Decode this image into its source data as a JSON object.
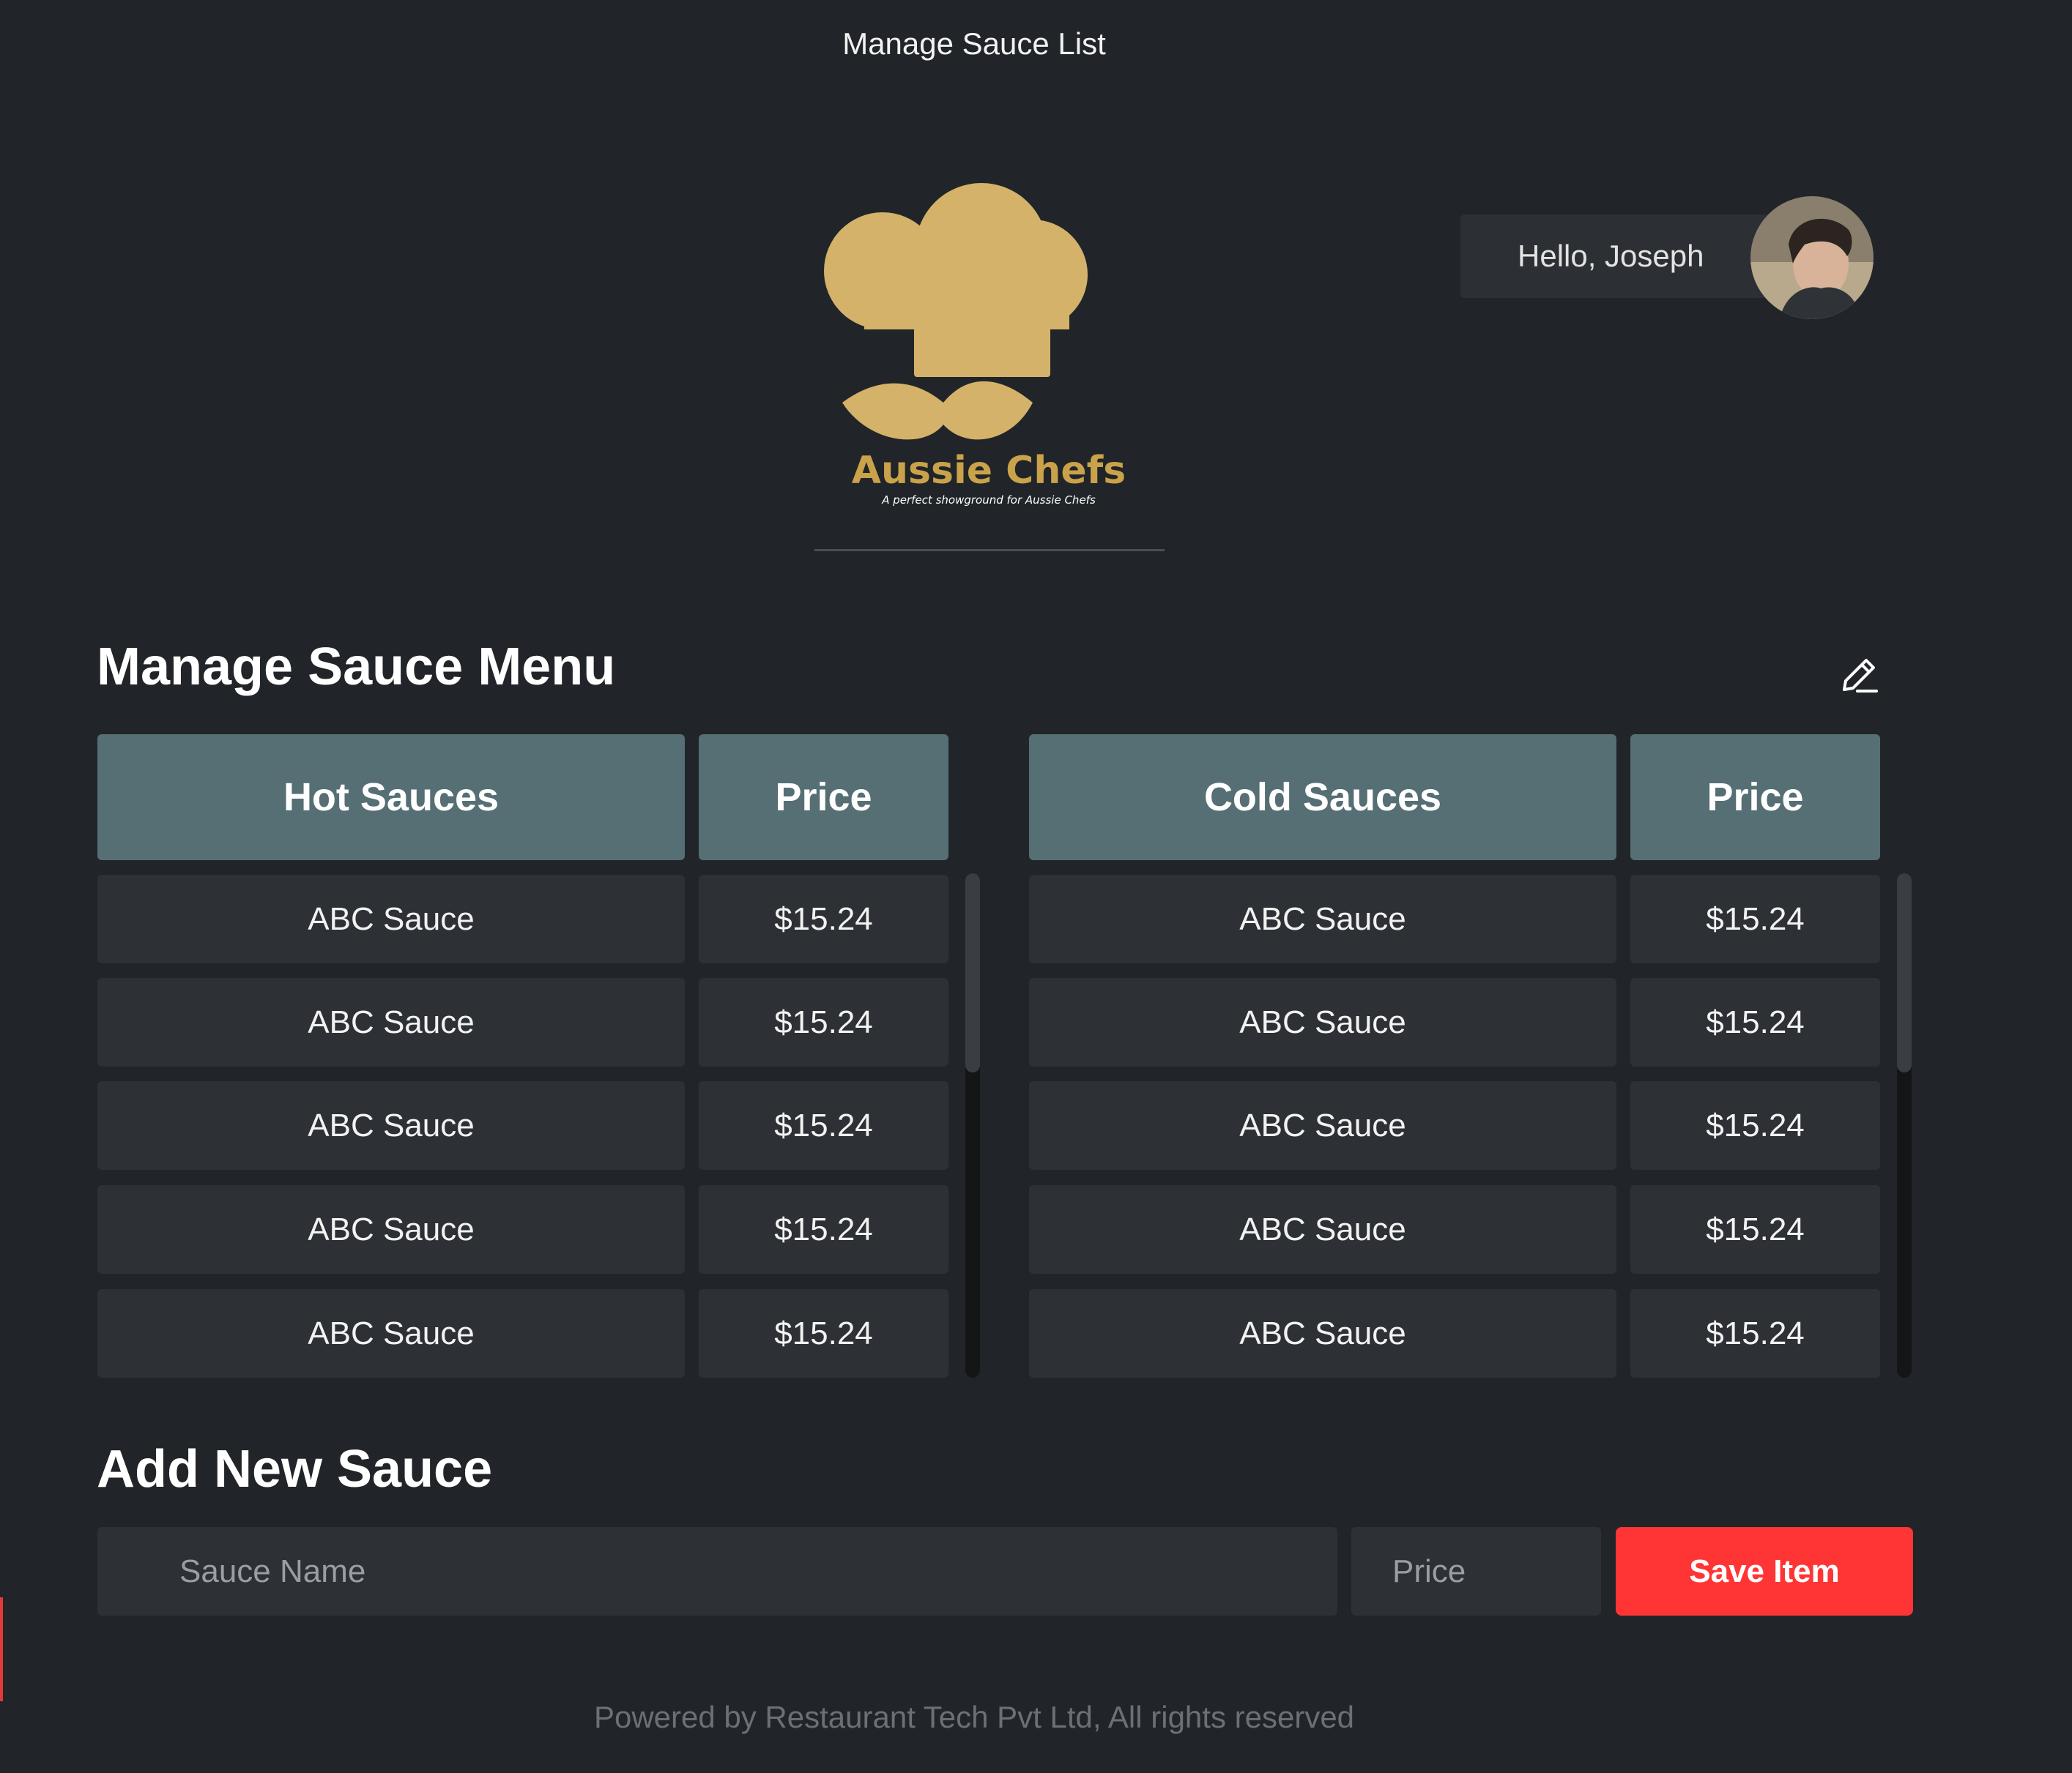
{
  "window": {
    "title": "Manage Sauce List"
  },
  "brand": {
    "name": "Aussie Chefs",
    "tagline": "A perfect showground for Aussie Chefs",
    "color": "#d4b26a"
  },
  "user": {
    "greeting": "Hello, Joseph"
  },
  "menu": {
    "title": "Manage Sauce Menu",
    "hot": {
      "header": "Hot Sauces",
      "price_header": "Price",
      "rows": [
        {
          "name": "ABC Sauce",
          "price": "$15.24"
        },
        {
          "name": "ABC Sauce",
          "price": "$15.24"
        },
        {
          "name": "ABC Sauce",
          "price": "$15.24"
        },
        {
          "name": "ABC Sauce",
          "price": "$15.24"
        },
        {
          "name": "ABC Sauce",
          "price": "$15.24"
        }
      ]
    },
    "cold": {
      "header": "Cold Sauces",
      "price_header": "Price",
      "rows": [
        {
          "name": "ABC Sauce",
          "price": "$15.24"
        },
        {
          "name": "ABC Sauce",
          "price": "$15.24"
        },
        {
          "name": "ABC Sauce",
          "price": "$15.24"
        },
        {
          "name": "ABC Sauce",
          "price": "$15.24"
        },
        {
          "name": "ABC Sauce",
          "price": "$15.24"
        }
      ]
    }
  },
  "add": {
    "title": "Add New Sauce",
    "name_placeholder": "Sauce Name",
    "price_placeholder": "Price",
    "save_label": "Save Item"
  },
  "footer": {
    "text": "Powered by Restaurant Tech Pvt Ltd, All rights reserved"
  },
  "colors": {
    "background": "#212529",
    "header_cell": "#566f74",
    "cell": "#2d3035",
    "accent": "#ff3535"
  }
}
